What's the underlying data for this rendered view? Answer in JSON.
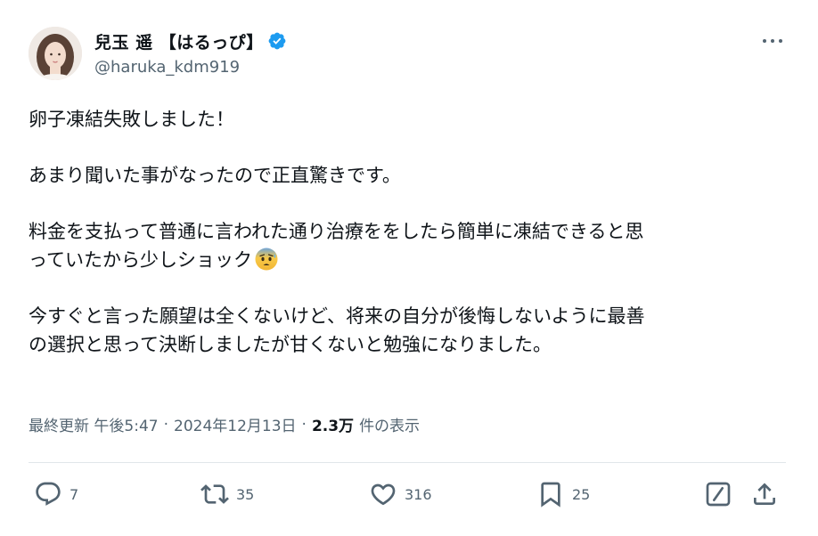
{
  "author": {
    "display_name": "兒玉 遥 【はるっぴ】",
    "handle": "@haruka_kdm919",
    "verified": true
  },
  "post": {
    "paragraphs": [
      [
        "卵子凍結失敗しました！"
      ],
      [
        "あまり聞いた事がなったので正直驚きです。"
      ],
      [
        "料金を支払って普通に言われた通り治療ををしたら簡単に凍結できると思",
        "っていたから少しショック"
      ],
      [
        "今すぐと言った願望は全くないけど、将来の自分が後悔しないように最善",
        "の選択と思って決断しましたが甘くないと勉強になりました。"
      ]
    ],
    "emoji": "anxious-face-with-sweat"
  },
  "meta": {
    "edited_time": "最終更新 午後5:47",
    "separator": "·",
    "date": "2024年12月13日",
    "views_count": "2.3万",
    "views_label": "件の表示"
  },
  "actions": {
    "reply_count": "7",
    "repost_count": "35",
    "like_count": "316",
    "bookmark_count": "25"
  },
  "colors": {
    "text": "#0f1419",
    "secondary": "#536471",
    "verified": "#1d9bf0",
    "divider": "#e1e6ea"
  }
}
